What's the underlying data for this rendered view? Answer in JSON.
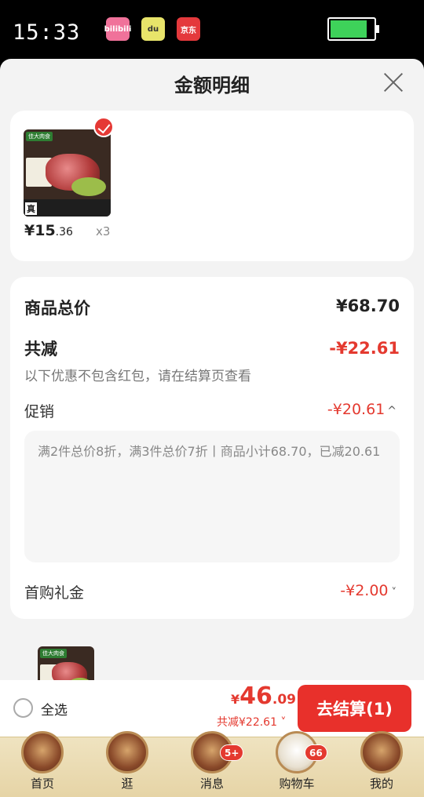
{
  "status_bar": {
    "time": "15:33",
    "apps": [
      {
        "name": "bilibili",
        "label": "bilibili"
      },
      {
        "name": "du",
        "label": "du"
      },
      {
        "name": "jd",
        "label": "京东"
      }
    ],
    "battery_level": 0.85
  },
  "sheet": {
    "title": "金额明细"
  },
  "item": {
    "price_main": "¥15",
    "price_decimal": ".36",
    "quantity": "x3",
    "thumb_tag": "佳大肉食",
    "thumb_badge": "真"
  },
  "summary": {
    "goods_total_label": "商品总价",
    "goods_total_value": "¥68.70",
    "discount_label": "共减",
    "discount_value": "-¥22.61",
    "discount_note": "以下优惠不包含红包，请在结算页查看",
    "promo_label": "促销",
    "promo_value": "-¥20.61",
    "promo_detail": "满2件总价8折，满3件总价7折丨商品小计68.70，已减20.61",
    "first_purchase_label": "首购礼金",
    "first_purchase_value": "-¥2.00"
  },
  "cart_bar": {
    "select_all_label": "全选",
    "total_yen": "¥",
    "total_int": "46",
    "total_dec": ".09",
    "total_discount": "共减¥22.61 ˅",
    "checkout_label": "去结算(1)"
  },
  "tabs": [
    {
      "label": "首页",
      "badge": ""
    },
    {
      "label": "逛",
      "badge": ""
    },
    {
      "label": "消息",
      "badge": "5+"
    },
    {
      "label": "购物车",
      "badge": "66"
    },
    {
      "label": "我的",
      "badge": ""
    }
  ],
  "colors": {
    "accent_red": "#e4392f",
    "checkout_button": "#e8302b",
    "tab_bar_bg": "#efe3c0"
  }
}
